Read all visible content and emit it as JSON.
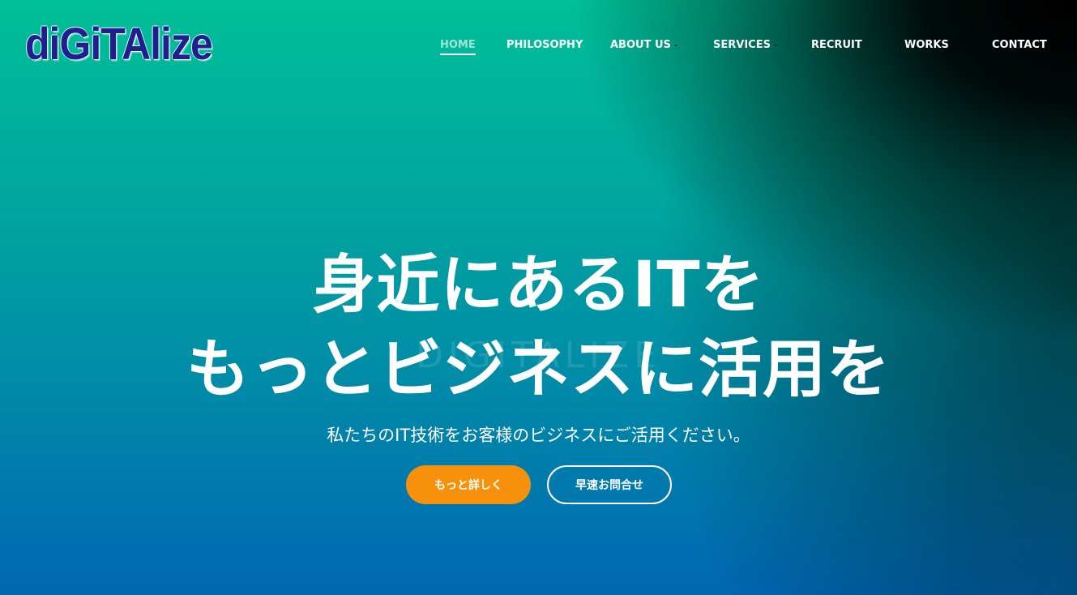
{
  "brand": {
    "logo_text": "diGiTAlize"
  },
  "nav": {
    "items": [
      {
        "label": "HOME",
        "has_dropdown": false,
        "active": true
      },
      {
        "label": "PHILOSOPHY",
        "has_dropdown": false,
        "active": false
      },
      {
        "label": "ABOUT US",
        "has_dropdown": true,
        "active": false
      },
      {
        "label": "SERVICES",
        "has_dropdown": true,
        "active": false
      },
      {
        "label": "RECRUIT",
        "has_dropdown": true,
        "active": false
      },
      {
        "label": "WORKS",
        "has_dropdown": false,
        "active": false
      },
      {
        "label": "CONTACT",
        "has_dropdown": false,
        "active": false
      }
    ],
    "dropdown_glyph": "⌄"
  },
  "hero": {
    "headline_line1": "身近にあるITを",
    "headline_line2": "もっとビジネスに活用を",
    "watermark": "DIGITALIZE",
    "subtitle": "私たちのIT技術をお客様のビジネスにご活用ください。",
    "primary_button": "もっと詳しく",
    "secondary_button": "早速お問合せ"
  },
  "colors": {
    "gradient_top": "#00bf98",
    "gradient_bottom": "#0067b2",
    "accent_orange": "#f7900b",
    "logo_navy": "#1f1f8f",
    "nav_active": "#9fe3d8"
  },
  "icons": [
    "chevron-down-icon"
  ]
}
